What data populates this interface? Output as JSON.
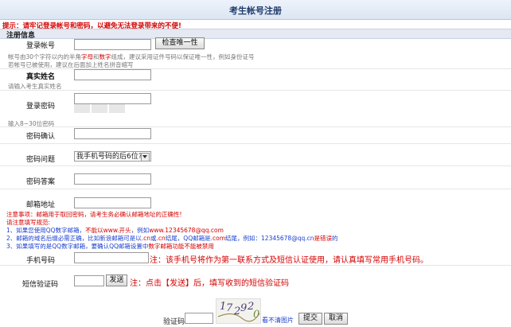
{
  "page_title": "考生帐号注册",
  "warning": "提示：请牢记登录帐号和密码，以避免无法登录带来的不便!",
  "section_title": "注册信息",
  "account": {
    "label": "登录帐号",
    "check_button": "检查唯一性",
    "hint_line1_a": "帐号由30个字符以内的半角",
    "hint_line1_b": "字母",
    "hint_line1_c": "和",
    "hint_line1_d": "数字",
    "hint_line1_e": "组成，建议采用证件号码以保证唯一性，例如身份证号",
    "hint_line2": "若帐号已被使用，建议在后面加上姓名拼音缩写"
  },
  "realname": {
    "label": "真实姓名",
    "hint": "请输入考生真实姓名"
  },
  "password": {
    "label": "登录密码",
    "hint": "输入8~30位密码"
  },
  "confirm": {
    "label": "密码确认"
  },
  "question": {
    "label": "密码问题",
    "selected": "我手机号码的后6位?"
  },
  "answer": {
    "label": "密码答案"
  },
  "email": {
    "label": "邮箱地址",
    "notice": "注意事项：邮箱用于取回密码，请考生务必确认邮箱地址的正确性!",
    "rules_title": "请注意填写规范:",
    "rule1_a": "1、如果您使用QQ数字邮箱，",
    "rule1_b": "不能以www.开头",
    "rule1_c": "，例如",
    "rule1_d": "www.12345678@qq.com",
    "rule2_a": "2、邮箱的域名后缀必需正确，比如新浪邮箱可是以",
    "rule2_b": ".cn",
    "rule2_c": "或",
    "rule2_d": ".cn",
    "rule2_e": "结尾，QQ邮箱是",
    "rule2_f": ".com",
    "rule2_g": "结尾，例如：",
    "rule2_h": "12345678@qq.cn",
    "rule2_i": "是",
    "rule2_j": "错误",
    "rule2_k": "的",
    "rule3_a": "3、如果填写的是QQ数字邮箱，要确认QQ邮箱设置中",
    "rule3_b": "数字邮箱功能不能被禁用"
  },
  "phone": {
    "label": "手机号码",
    "note": "注：该手机号将作为第一联系方式及短信认证使用，请认真填写常用手机号码。"
  },
  "sms": {
    "label": "短信验证码",
    "send_button": "发送",
    "note": "注：点击【发送】后，填写收到的短信验证码"
  },
  "captcha": {
    "label": "验证码",
    "chars": [
      "1",
      "7",
      "2",
      "9",
      "2",
      "0"
    ],
    "refresh": "看不清图片"
  },
  "submit_button": "提交",
  "cancel_button": "取消",
  "colors": {
    "accent": "#1f3a6a",
    "warning": "#d40000",
    "link": "#1a3fd0"
  }
}
